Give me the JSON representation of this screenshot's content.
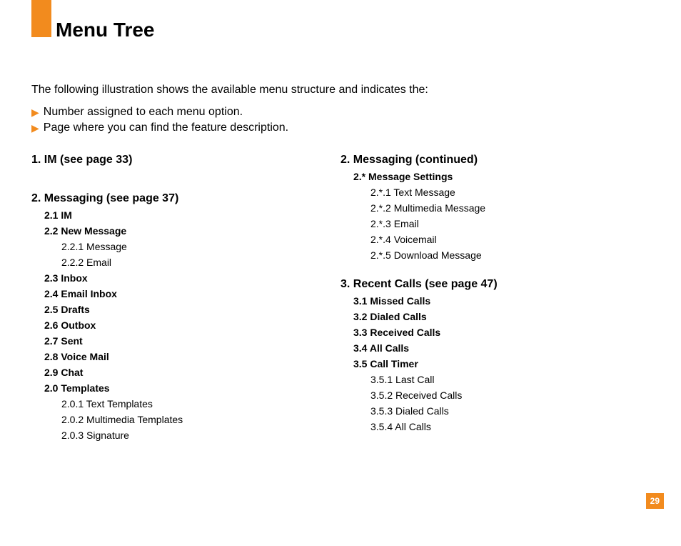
{
  "title": "Menu Tree",
  "intro": "The following illustration shows the available menu structure and indicates the:",
  "bullets": [
    "Number assigned to each menu option.",
    "Page where you can find the feature description."
  ],
  "left": {
    "s1": "1.  IM (see page 33)",
    "s2": "2.  Messaging (see page 37)",
    "s2_items": {
      "i1": "2.1 IM",
      "i2": "2.2 New Message",
      "i2_1": "2.2.1 Message",
      "i2_2": "2.2.2 Email",
      "i3": "2.3 Inbox",
      "i4": "2.4 Email Inbox",
      "i5": "2.5 Drafts",
      "i6": "2.6 Outbox",
      "i7": "2.7 Sent",
      "i8": "2.8 Voice Mail",
      "i9": "2.9 Chat",
      "i10": "2.0 Templates",
      "i10_1": "2.0.1 Text Templates",
      "i10_2": "2.0.2 Multimedia Templates",
      "i10_3": "2.0.3 Signature"
    }
  },
  "right": {
    "s2c": "2.  Messaging (continued)",
    "ms": "2.* Message Settings",
    "ms_items": {
      "i1": "2.*.1 Text Message",
      "i2": "2.*.2 Multimedia Message",
      "i3": "2.*.3 Email",
      "i4": "2.*.4 Voicemail",
      "i5": "2.*.5 Download Message"
    },
    "s3": "3.  Recent Calls (see page 47)",
    "s3_items": {
      "i1": "3.1 Missed Calls",
      "i2": "3.2 Dialed Calls",
      "i3": "3.3 Received Calls",
      "i4": "3.4 All Calls",
      "i5": "3.5 Call Timer",
      "i5_1": "3.5.1 Last Call",
      "i5_2": "3.5.2 Received Calls",
      "i5_3": "3.5.3 Dialed Calls",
      "i5_4": "3.5.4 All Calls"
    }
  },
  "page_number": "29"
}
